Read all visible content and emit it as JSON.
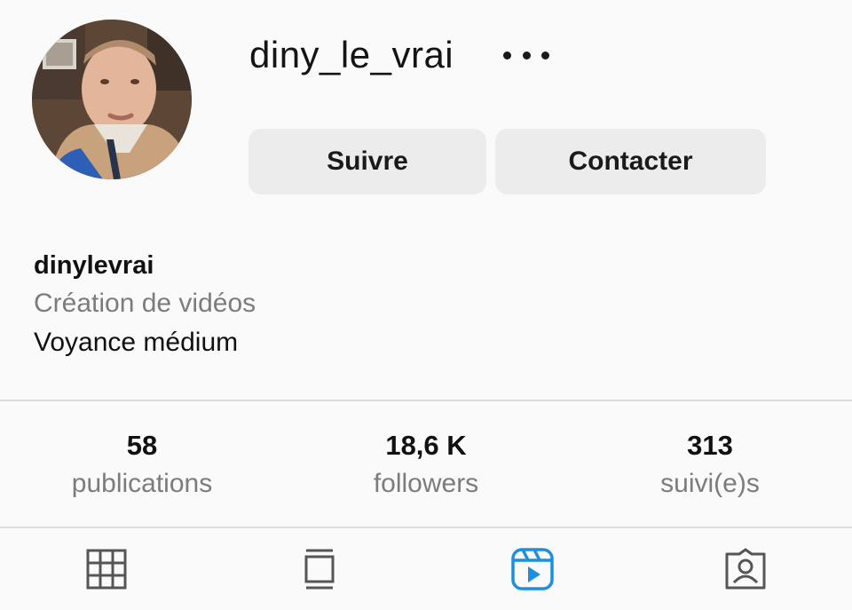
{
  "profile": {
    "username": "diny_le_vrai",
    "more_icon": "more-horizontal-icon",
    "avatar_icon": "profile-photo"
  },
  "actions": {
    "follow_label": "Suivre",
    "contact_label": "Contacter"
  },
  "bio": {
    "name": "dinylevrai",
    "category": "Création de vidéos",
    "text": "Voyance médium"
  },
  "stats": [
    {
      "value": "58",
      "label": "publications"
    },
    {
      "value": "18,6 K",
      "label": "followers"
    },
    {
      "value": "313",
      "label": "suivi(e)s"
    }
  ],
  "tabs": [
    {
      "icon": "grid-icon",
      "active": false
    },
    {
      "icon": "feed-icon",
      "active": false
    },
    {
      "icon": "reels-icon",
      "active": true
    },
    {
      "icon": "tagged-icon",
      "active": false
    }
  ],
  "colors": {
    "background": "#fafafa",
    "button_bg": "#ececec",
    "muted_text": "#7c7c7c",
    "active_tab": "#1d8fe0",
    "inactive_tab": "#555555"
  }
}
